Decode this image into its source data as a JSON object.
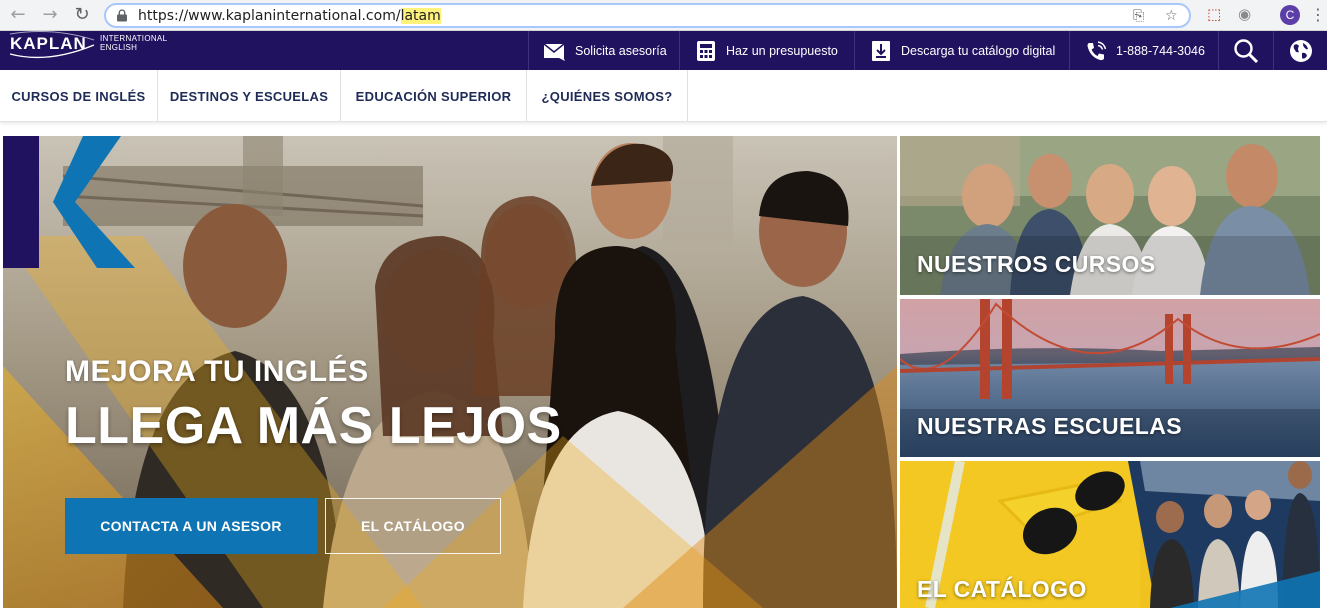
{
  "browser": {
    "url_base": "https://www.kaplaninternational.com/",
    "url_path": "latam",
    "profile_initial": "C"
  },
  "topbar": {
    "logo_text": "KAPLAN",
    "logo_sub_1": "INTERNATIONAL",
    "logo_sub_2": "ENGLISH",
    "items": [
      {
        "label": "Solicita asesoría",
        "icon": "envelope-icon"
      },
      {
        "label": "Haz un presupuesto",
        "icon": "calculator-icon"
      },
      {
        "label": "Descarga tu catálogo digital",
        "icon": "download-icon"
      },
      {
        "label": "1-888-744-3046",
        "icon": "phone-icon"
      }
    ]
  },
  "mainnav": {
    "items": [
      "CURSOS DE INGLÉS",
      "DESTINOS Y ESCUELAS",
      "EDUCACIÓN SUPERIOR",
      "¿QUIÉNES SOMOS?"
    ]
  },
  "hero": {
    "subtitle": "MEJORA TU INGLÉS",
    "title": "LLEGA MÁS LEJOS",
    "primary_button": "CONTACTA A UN ASESOR",
    "secondary_button": "EL CATÁLOGO"
  },
  "tiles": [
    {
      "label": "NUESTROS CURSOS"
    },
    {
      "label": "NUESTRAS ESCUELAS"
    },
    {
      "label": "EL CATÁLOGO"
    }
  ],
  "colors": {
    "brand_purple": "#20125f",
    "accent_blue": "#0f74b4",
    "nav_text": "#1f2b57"
  }
}
